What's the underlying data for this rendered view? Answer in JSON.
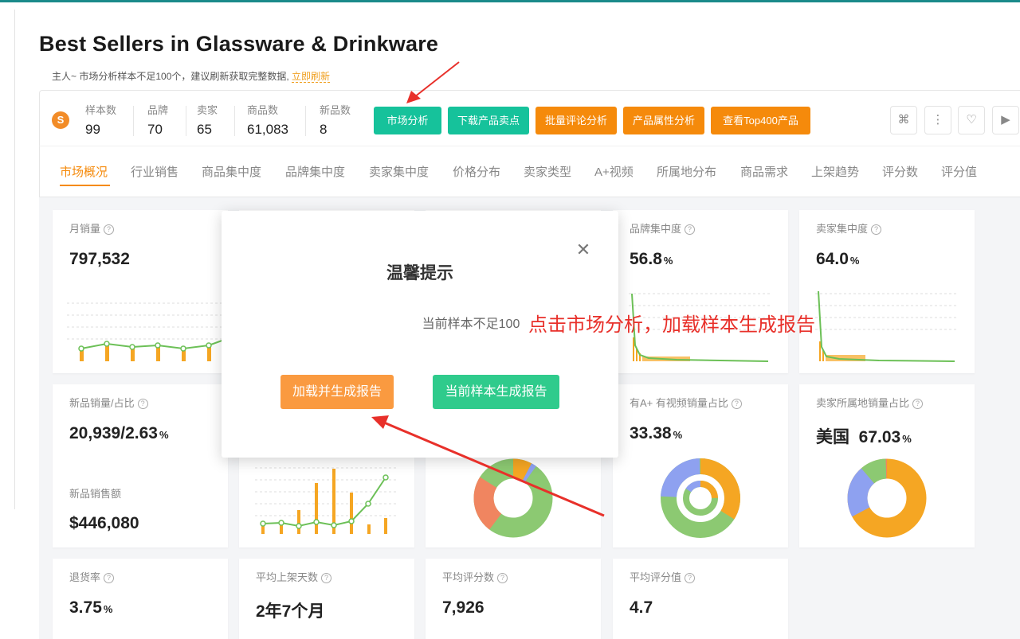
{
  "page": {
    "title": "Best Sellers in Glassware & Drinkware",
    "notice_prefix": "主人~ 市场分析样本不足100个，建议刷新获取完整数据,",
    "notice_link": "立即刷新"
  },
  "summary": {
    "logo": "S",
    "stats": [
      {
        "label": "样本数",
        "value": "99"
      },
      {
        "label": "品牌",
        "value": "70"
      },
      {
        "label": "卖家",
        "value": "65"
      },
      {
        "label": "商品数",
        "value": "61,083"
      },
      {
        "label": "新品数",
        "value": "8"
      }
    ],
    "buttons": [
      {
        "label": "市场分析",
        "style": "teal"
      },
      {
        "label": "下载产品卖点",
        "style": "teal"
      },
      {
        "label": "批量评论分析",
        "style": "orange"
      },
      {
        "label": "产品属性分析",
        "style": "orange"
      },
      {
        "label": "查看Top400产品",
        "style": "orange"
      }
    ],
    "icons": [
      "command-icon",
      "more-vertical-icon",
      "heart-icon",
      "play-icon"
    ]
  },
  "tabs": [
    "市场概况",
    "行业销售",
    "商品集中度",
    "品牌集中度",
    "卖家集中度",
    "价格分布",
    "卖家类型",
    "A+视频",
    "所属地分布",
    "商品需求",
    "上架趋势",
    "评分数",
    "评分值"
  ],
  "active_tab": "市场概况",
  "cards": {
    "monthly_sales": {
      "label": "月销量",
      "value": "797,532"
    },
    "brand_concentration": {
      "label": "品牌集中度",
      "value": "56.8",
      "unit": "%"
    },
    "seller_concentration": {
      "label": "卖家集中度",
      "value": "64.0",
      "unit": "%"
    },
    "new_product_sales": {
      "label": "新品销量/占比",
      "value": "20,939/2.63",
      "unit": "%",
      "sub_label": "新品销售额",
      "sub_value": "$446,080"
    },
    "aplus_video": {
      "label": "有A+ 有视频销量占比",
      "value": "33.38",
      "unit": "%"
    },
    "seller_location": {
      "label": "卖家所属地销量占比",
      "country": "美国",
      "value": "67.03",
      "unit": "%"
    },
    "return_rate": {
      "label": "退货率",
      "value": "3.75",
      "unit": "%"
    },
    "avg_listing_days": {
      "label": "平均上架天数",
      "value": "2年7个月"
    },
    "avg_review_count": {
      "label": "平均评分数",
      "value": "7,926"
    },
    "avg_rating": {
      "label": "平均评分值",
      "value": "4.7"
    }
  },
  "modal": {
    "title": "温馨提示",
    "message_prefix": "当前样本不足",
    "message_number": "100",
    "load_button": "加载并生成报告",
    "current_button": "当前样本生成报告"
  },
  "annotation": "点击市场分析，加载样本生成报告",
  "colors": {
    "teal": "#16c29b",
    "orange": "#f58a0b",
    "red_annotation": "#e8302a",
    "chart_green": "#6cc057",
    "chart_orange": "#f5a623",
    "chart_blue": "#8ea1f0"
  }
}
